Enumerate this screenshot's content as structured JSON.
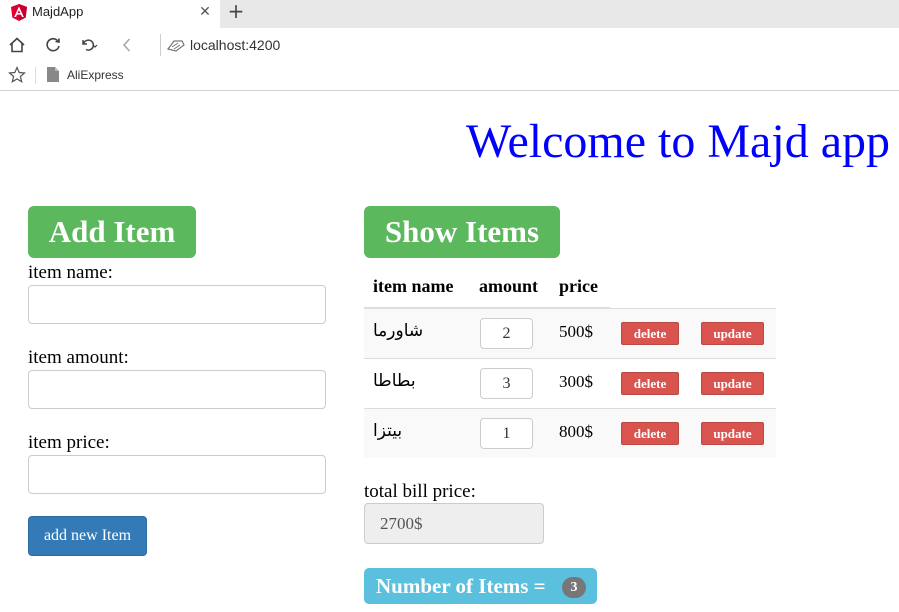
{
  "browser": {
    "tab_title": "MajdApp",
    "close_glyph": "✕",
    "new_tab_glyph": "+",
    "address": "localhost:4200",
    "favorites": [
      {
        "label": "AliExpress"
      }
    ],
    "icons": [
      "angular-favicon",
      "home-icon",
      "refresh-icon",
      "undo-icon",
      "back-icon",
      "fax-icon",
      "star-icon",
      "page-icon"
    ]
  },
  "header": {
    "title": "Welcome to Majd app"
  },
  "add_item": {
    "heading": "Add Item",
    "name_label": "item name:",
    "amount_label": "item amount:",
    "price_label": "item price:",
    "name_value": "",
    "amount_value": "",
    "price_value": "",
    "submit_label": "add new Item"
  },
  "show_items": {
    "heading": "Show Items",
    "columns": [
      "item name",
      "amount",
      "price"
    ],
    "rows": [
      {
        "name": "شاورما",
        "amount": "2",
        "price": "500$",
        "delete_label": "delete",
        "update_label": "update"
      },
      {
        "name": "بطاطا",
        "amount": "3",
        "price": "300$",
        "delete_label": "delete",
        "update_label": "update"
      },
      {
        "name": "بيتزا",
        "amount": "1",
        "price": "800$",
        "delete_label": "delete",
        "update_label": "update"
      }
    ],
    "total_label": "total bill price:",
    "total_value": "2700$",
    "count_label": "Number of Items =",
    "count_value": "3"
  },
  "colors": {
    "welcome": "#0000ff",
    "success": "#5cb85c",
    "primary": "#337ab7",
    "danger": "#d9534f",
    "info": "#5bc0de",
    "badge": "#777777"
  }
}
